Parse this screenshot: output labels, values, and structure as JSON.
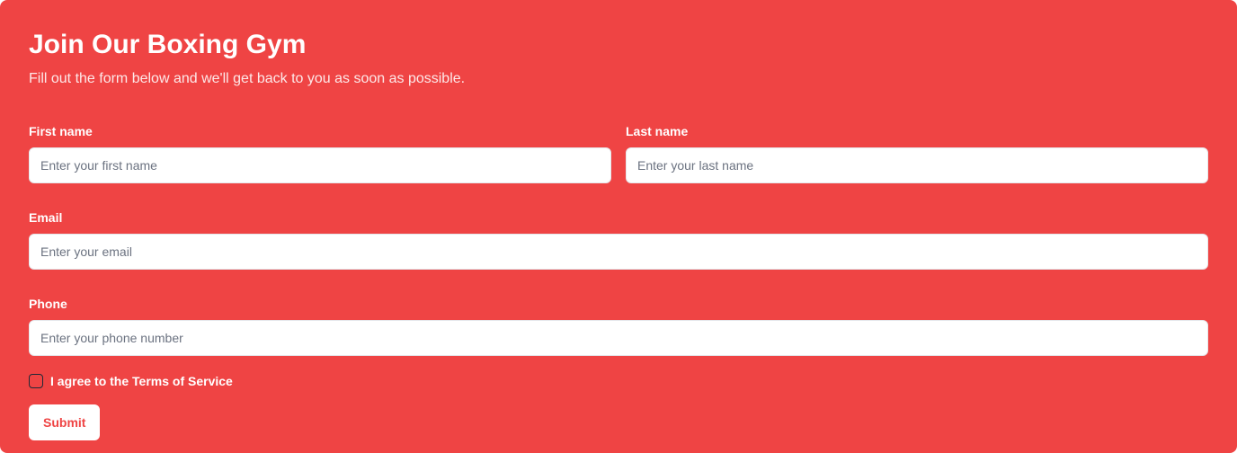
{
  "header": {
    "title": "Join Our Boxing Gym",
    "subtitle": "Fill out the form below and we'll get back to you as soon as possible."
  },
  "form": {
    "first_name": {
      "label": "First name",
      "placeholder": "Enter your first name",
      "value": ""
    },
    "last_name": {
      "label": "Last name",
      "placeholder": "Enter your last name",
      "value": ""
    },
    "email": {
      "label": "Email",
      "placeholder": "Enter your email",
      "value": ""
    },
    "phone": {
      "label": "Phone",
      "placeholder": "Enter your phone number",
      "value": ""
    },
    "terms": {
      "label": "I agree to the Terms of Service",
      "checked": false
    },
    "submit_label": "Submit"
  },
  "colors": {
    "background": "#ef4444",
    "button_bg": "#ffffff",
    "button_text": "#ef4444"
  }
}
